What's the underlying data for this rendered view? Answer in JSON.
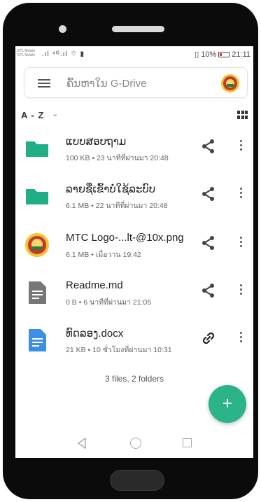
{
  "status_bar": {
    "carrier_1": "ETL Mobile",
    "carrier_2": "ETL Mobile",
    "signal": ".ıl ⁴ᴳ.ıl ⌔ ▮",
    "battery_text": "10%",
    "time": "21:11"
  },
  "search": {
    "placeholder": "ຄົ້ນຫາໃນ G-Drive"
  },
  "sort": {
    "label": "A - Z",
    "chevron": "⌄"
  },
  "files": [
    {
      "name": "ແບບສອບຖາມ",
      "meta": "100 KB • 23 นาทีที่ผ่านมา 20:48",
      "type": "folder",
      "action": "share"
    },
    {
      "name": "ລາຍຊື່ເຂົ້າບໍ່ໃຊ້ລະບົບ",
      "meta": "6.1 MB • 22 นาทีที่ผ่านมา 20:48",
      "type": "folder",
      "action": "share"
    },
    {
      "name": "MTC Logo-...lt-@10x.png",
      "meta": "6.1 MB • เมื่อวาน 19:42",
      "type": "image",
      "action": "share"
    },
    {
      "name": "Readme.md",
      "meta": "0 B • 6 นาทีที่ผ่านมา 21:05",
      "type": "text",
      "action": "share"
    },
    {
      "name": "ທົດລອງ.docx",
      "meta": "21 KB • 10 ชั่วโมงที่ผ่านมา 10:31",
      "type": "doc",
      "action": "link"
    }
  ],
  "summary": "3 files, 2 folders",
  "fab_label": "+",
  "colors": {
    "folder": "#1fae85",
    "doc": "#3d8fe3",
    "text_file": "#777777",
    "fab": "#2bb38a"
  },
  "icons": {
    "menu": "hamburger-icon",
    "grid": "grid-view-icon",
    "share": "share-icon",
    "link": "link-icon",
    "more": "more-vert-icon"
  }
}
